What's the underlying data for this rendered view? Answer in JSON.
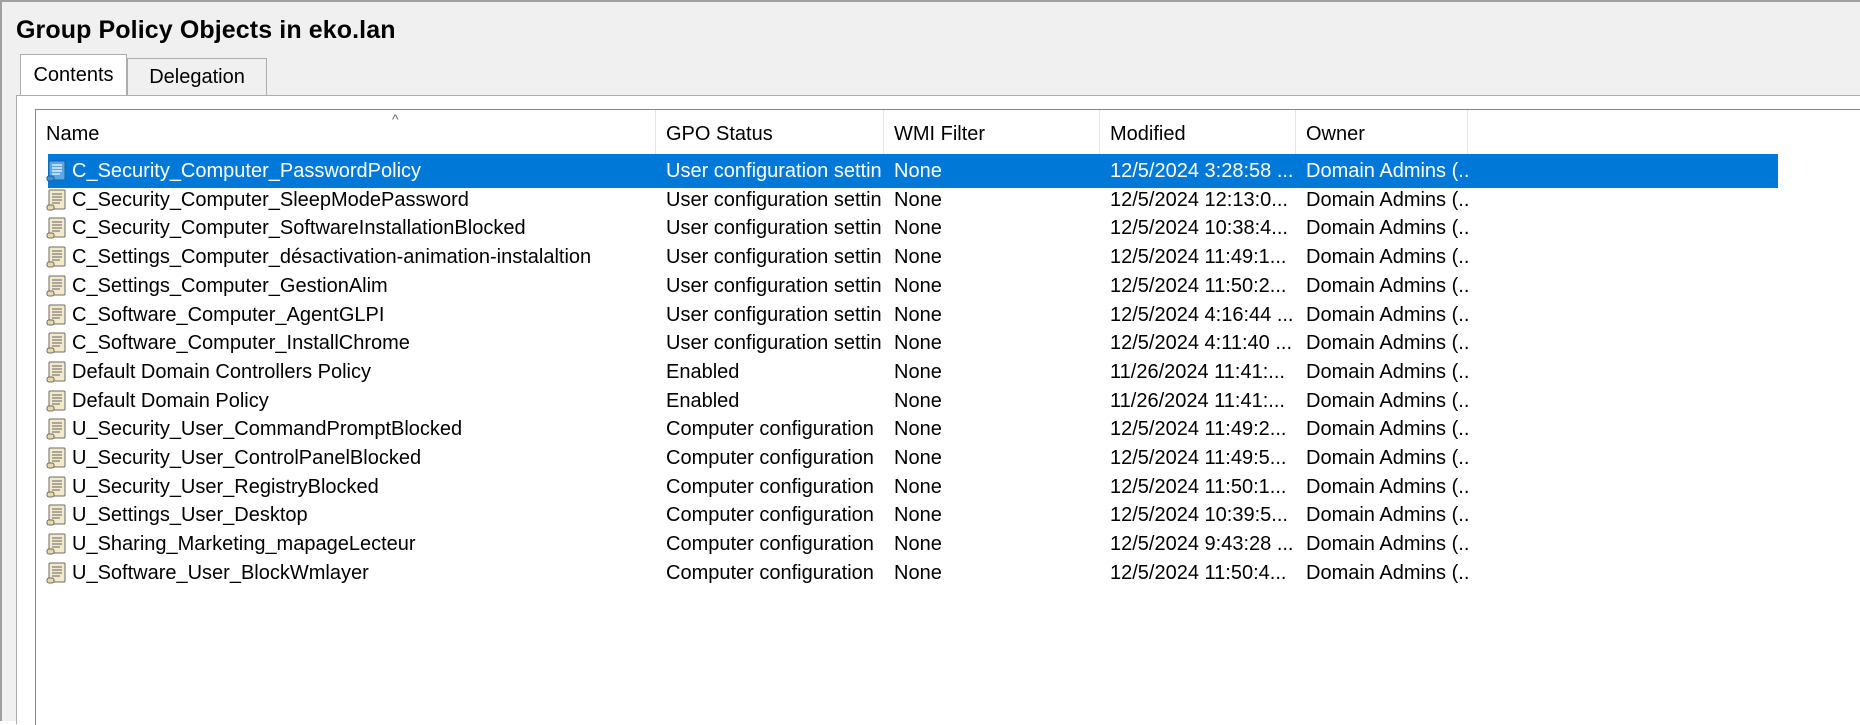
{
  "window": {
    "title": "Group Policy Objects in eko.lan"
  },
  "tabs": [
    {
      "label": "Contents"
    },
    {
      "label": "Delegation"
    }
  ],
  "columns": {
    "name": "Name",
    "status": "GPO Status",
    "wmi": "WMI Filter",
    "modified": "Modified",
    "owner": "Owner"
  },
  "sort_indicator": "^",
  "selected_row_index": 0,
  "rows": [
    {
      "name": "C_Security_Computer_PasswordPolicy",
      "status": "User configuration settin...",
      "wmi": "None",
      "modified": "12/5/2024 3:28:58 ...",
      "owner": "Domain Admins (..."
    },
    {
      "name": "C_Security_Computer_SleepModePassword",
      "status": "User configuration settin...",
      "wmi": "None",
      "modified": "12/5/2024 12:13:0...",
      "owner": "Domain Admins (..."
    },
    {
      "name": "C_Security_Computer_SoftwareInstallationBlocked",
      "status": "User configuration settin...",
      "wmi": "None",
      "modified": "12/5/2024 10:38:4...",
      "owner": "Domain Admins (..."
    },
    {
      "name": "C_Settings_Computer_désactivation-animation-instalaltion",
      "status": "User configuration settin...",
      "wmi": "None",
      "modified": "12/5/2024 11:49:1...",
      "owner": "Domain Admins (..."
    },
    {
      "name": "C_Settings_Computer_GestionAlim",
      "status": "User configuration settin...",
      "wmi": "None",
      "modified": "12/5/2024 11:50:2...",
      "owner": "Domain Admins (..."
    },
    {
      "name": "C_Software_Computer_AgentGLPI",
      "status": "User configuration settin...",
      "wmi": "None",
      "modified": "12/5/2024 4:16:44 ...",
      "owner": "Domain Admins (..."
    },
    {
      "name": "C_Software_Computer_InstallChrome",
      "status": "User configuration settin...",
      "wmi": "None",
      "modified": "12/5/2024 4:11:40 ...",
      "owner": "Domain Admins (..."
    },
    {
      "name": "Default Domain Controllers Policy",
      "status": "Enabled",
      "wmi": "None",
      "modified": "11/26/2024 11:41:...",
      "owner": "Domain Admins (..."
    },
    {
      "name": "Default Domain Policy",
      "status": "Enabled",
      "wmi": "None",
      "modified": "11/26/2024 11:41:...",
      "owner": "Domain Admins (..."
    },
    {
      "name": "U_Security_User_CommandPromptBlocked",
      "status": "Computer configuration ...",
      "wmi": "None",
      "modified": "12/5/2024 11:49:2...",
      "owner": "Domain Admins (..."
    },
    {
      "name": "U_Security_User_ControlPanelBlocked",
      "status": "Computer configuration ...",
      "wmi": "None",
      "modified": "12/5/2024 11:49:5...",
      "owner": "Domain Admins (..."
    },
    {
      "name": "U_Security_User_RegistryBlocked",
      "status": "Computer configuration ...",
      "wmi": "None",
      "modified": "12/5/2024 11:50:1...",
      "owner": "Domain Admins (..."
    },
    {
      "name": "U_Settings_User_Desktop",
      "status": "Computer configuration ...",
      "wmi": "None",
      "modified": "12/5/2024 10:39:5...",
      "owner": "Domain Admins (..."
    },
    {
      "name": "U_Sharing_Marketing_mapageLecteur",
      "status": "Computer configuration ...",
      "wmi": "None",
      "modified": "12/5/2024 9:43:28 ...",
      "owner": "Domain Admins (..."
    },
    {
      "name": "U_Software_User_BlockWmlayer",
      "status": "Computer configuration ...",
      "wmi": "None",
      "modified": "12/5/2024 11:50:4...",
      "owner": "Domain Admins (..."
    }
  ],
  "colors": {
    "selection": "#0078d7",
    "border": "#adadad",
    "window_bg": "#f0f0f0"
  },
  "icons": {
    "row_icon": "gpo-scroll-icon"
  }
}
